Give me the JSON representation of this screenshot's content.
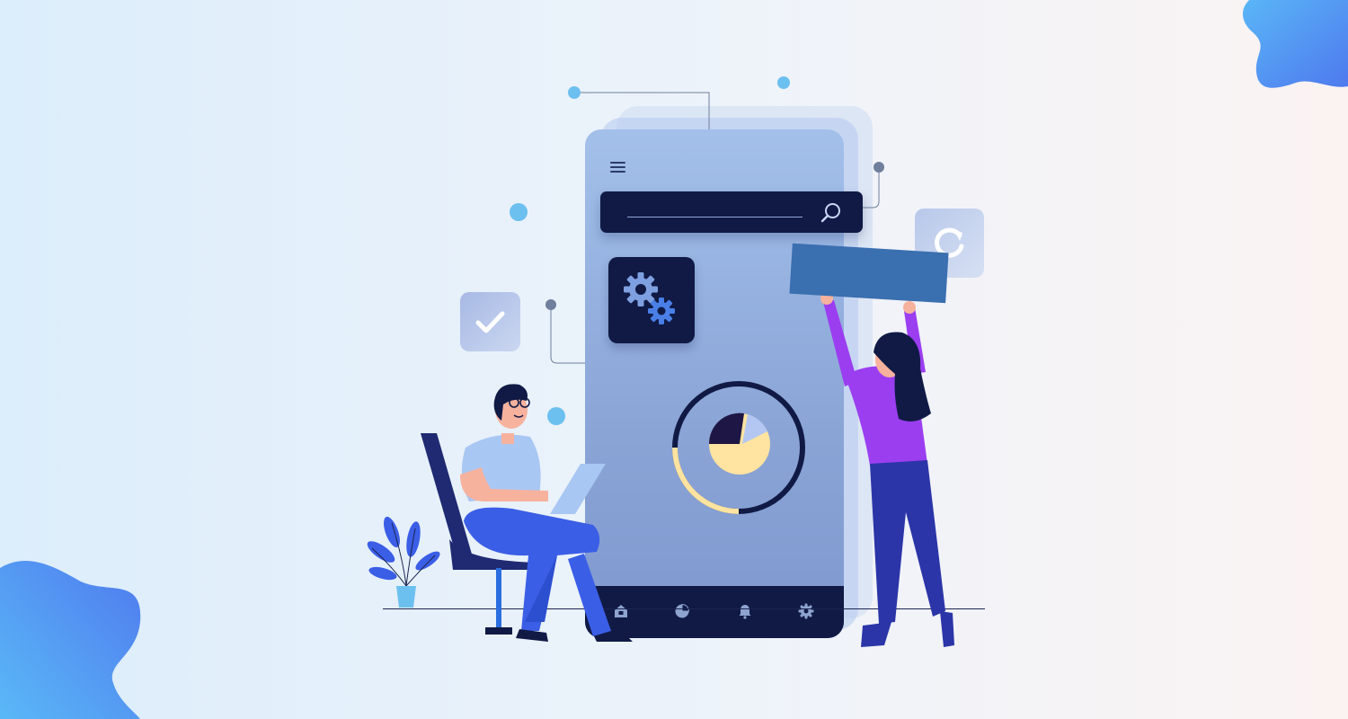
{
  "scene": {
    "background_colors": [
      "#dcedfb",
      "#eef3fa",
      "#fbf3f2"
    ],
    "accent_colors": {
      "navy": "#101a45",
      "phone_blue": "#93afe0",
      "purple": "#9b3ef0",
      "blue_person": "#3b5ee6",
      "yellow": "#ffe3a0",
      "cyan_dot": "#6cc0ef"
    }
  },
  "phone": {
    "menu_icon": "hamburger-menu-icon",
    "search": {
      "icon": "search-icon",
      "value": ""
    },
    "settings_tile_icon": "gears-icon",
    "chart_icon": "pie-chart-icon",
    "nav_items": [
      {
        "icon": "home-icon"
      },
      {
        "icon": "pie-chart-icon"
      },
      {
        "icon": "bell-icon"
      },
      {
        "icon": "gear-icon"
      }
    ]
  },
  "floating_tiles": {
    "left_tile_icon": "checkmark-icon",
    "right_tile_icon": "refresh-icon"
  },
  "people": {
    "left": "man-with-laptop-seated",
    "right": "woman-holding-panel"
  },
  "decor": {
    "plant": "potted-plant",
    "blobs": [
      "blob-top-right",
      "blob-bottom-left"
    ]
  }
}
